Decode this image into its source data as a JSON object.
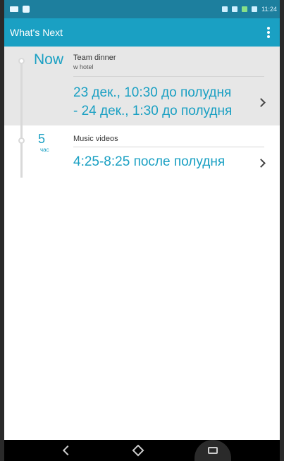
{
  "status_bar": {
    "time": "11:24",
    "icons": [
      "message-icon",
      "photo-icon",
      "battery-saver-icon",
      "wifi-icon",
      "signal-icon",
      "battery-icon"
    ]
  },
  "app_bar": {
    "title": "What's Next",
    "menu_icon": "overflow-menu-icon"
  },
  "events": [
    {
      "when": "Now",
      "title": "Team dinner",
      "subtitle": "w hotel",
      "time_line1": "23 дек., 10:30 до полудня",
      "time_line2": "- 24 дек., 1:30 до полудня"
    },
    {
      "when_number": "5",
      "when_unit": "час",
      "title": "Music videos",
      "time_line1": "4:25-8:25 после полудня"
    }
  ],
  "colors": {
    "accent": "#1aa0c3",
    "status_bar": "#1d7f9e",
    "nav_bar": "#000000"
  }
}
